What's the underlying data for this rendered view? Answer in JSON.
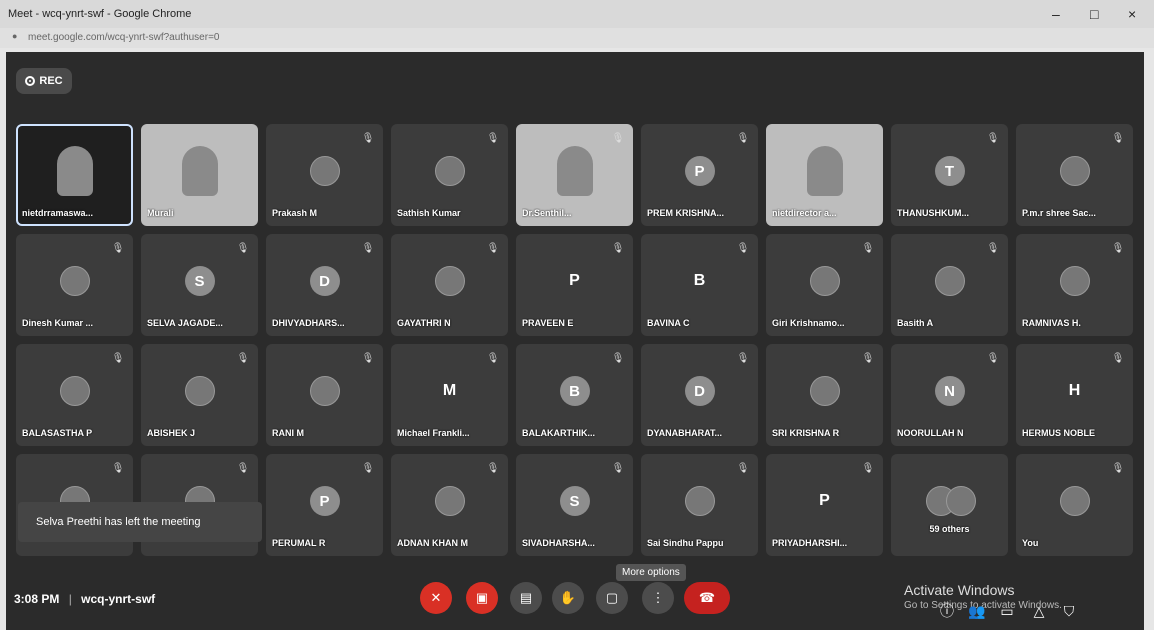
{
  "browser": {
    "title": "Meet - wcq-ynrt-swf - Google Chrome",
    "url": "meet.google.com/wcq-ynrt-swf?authuser=0",
    "controls": [
      "–",
      "□",
      "×"
    ]
  },
  "rec_label": "REC",
  "tiles": [
    {
      "name": "nietdrramaswa...",
      "kind": "video-active",
      "muted": false
    },
    {
      "name": "Murali",
      "kind": "video",
      "muted": false
    },
    {
      "name": "Prakash M",
      "kind": "photo",
      "muted": true
    },
    {
      "name": "Sathish Kumar",
      "kind": "photo",
      "muted": true
    },
    {
      "name": "Dr.Senthil...",
      "kind": "video",
      "muted": true
    },
    {
      "name": "PREM KRISHNA...",
      "kind": "letter",
      "letter": "P",
      "color": "#8e8e8e",
      "muted": true
    },
    {
      "name": "nietdirector a...",
      "kind": "video",
      "muted": false
    },
    {
      "name": "THANUSHKUM...",
      "kind": "letter",
      "letter": "T",
      "color": "#8e8e8e",
      "muted": true
    },
    {
      "name": "P.m.r shree Sac...",
      "kind": "photo",
      "muted": true
    },
    {
      "name": "Dinesh Kumar ...",
      "kind": "photo",
      "muted": true
    },
    {
      "name": "SELVA JAGADE...",
      "kind": "letter",
      "letter": "S",
      "color": "#8e8e8e",
      "muted": true
    },
    {
      "name": "DHIVYADHARS...",
      "kind": "letter",
      "letter": "D",
      "color": "#8e8e8e",
      "muted": true
    },
    {
      "name": "GAYATHRI N",
      "kind": "photo",
      "muted": true
    },
    {
      "name": "PRAVEEN E",
      "kind": "plain",
      "letter": "P",
      "muted": true
    },
    {
      "name": "BAVINA C",
      "kind": "plain",
      "letter": "B",
      "muted": true
    },
    {
      "name": "Giri Krishnamo...",
      "kind": "photo",
      "muted": true
    },
    {
      "name": "Basith A",
      "kind": "photo",
      "muted": true
    },
    {
      "name": "RAMNIVAS H.",
      "kind": "photo",
      "muted": true
    },
    {
      "name": "BALASASTHA P",
      "kind": "photo",
      "muted": true
    },
    {
      "name": "ABISHEK J",
      "kind": "photo",
      "muted": true
    },
    {
      "name": "RANI M",
      "kind": "photo",
      "muted": true
    },
    {
      "name": "Michael Frankli...",
      "kind": "plain",
      "letter": "M",
      "muted": true
    },
    {
      "name": "BALAKARTHIK...",
      "kind": "letter",
      "letter": "B",
      "color": "#8e8e8e",
      "muted": true
    },
    {
      "name": "DYANABHARAT...",
      "kind": "letter",
      "letter": "D",
      "color": "#8e8e8e",
      "muted": true
    },
    {
      "name": "SRI KRISHNA R",
      "kind": "photo",
      "muted": true
    },
    {
      "name": "NOORULLAH N",
      "kind": "letter",
      "letter": "N",
      "color": "#8e8e8e",
      "muted": true
    },
    {
      "name": "HERMUS NOBLE",
      "kind": "plain",
      "letter": "H",
      "muted": true
    },
    {
      "name": "",
      "kind": "photo",
      "muted": true
    },
    {
      "name": "",
      "kind": "photo",
      "muted": true
    },
    {
      "name": "PERUMAL R",
      "kind": "letter",
      "letter": "P",
      "color": "#8e8e8e",
      "muted": true
    },
    {
      "name": "ADNAN KHAN M",
      "kind": "photo",
      "muted": true
    },
    {
      "name": "SIVADHARSHA...",
      "kind": "letter",
      "letter": "S",
      "color": "#8e8e8e",
      "muted": true
    },
    {
      "name": "Sai Sindhu Pappu",
      "kind": "photo",
      "muted": true
    },
    {
      "name": "PRIYADHARSHI...",
      "kind": "plain",
      "letter": "P",
      "muted": true
    },
    {
      "name": "59 others",
      "kind": "others",
      "muted": false
    },
    {
      "name": "You",
      "kind": "photo",
      "muted": true
    }
  ],
  "toast": "Selva Preethi has left the meeting",
  "footer": {
    "time": "3:08 PM",
    "separator": "|",
    "meeting_code": "wcq-ynrt-swf"
  },
  "controls": {
    "tooltip": "More options"
  },
  "watermark": {
    "title": "Activate Windows",
    "subtitle": "Go to Settings to activate Windows."
  }
}
